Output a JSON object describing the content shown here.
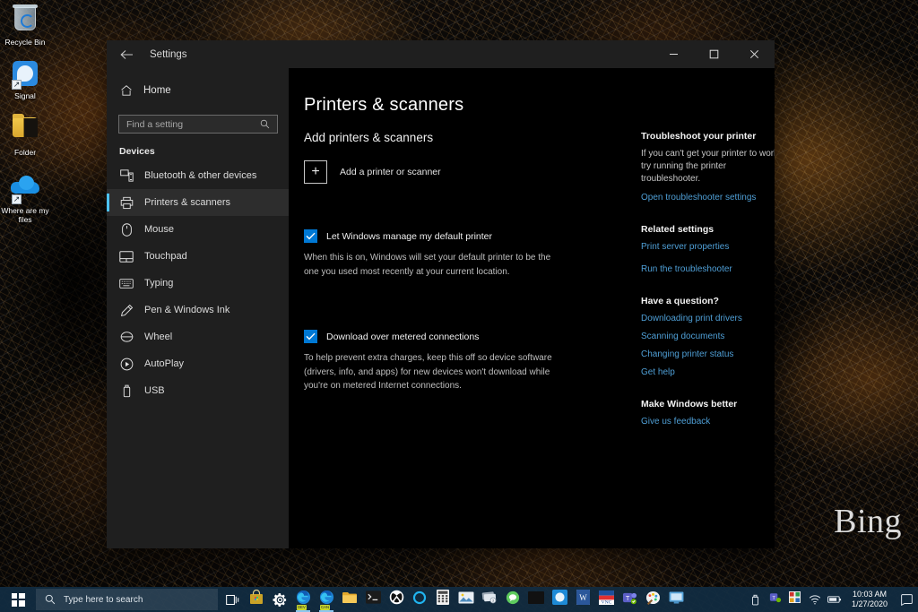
{
  "desktop": {
    "watermark": "Bing",
    "icons": [
      {
        "name": "recycle-bin",
        "label": "Recycle Bin",
        "icon": "recycle-bin-icon",
        "shortcut": false
      },
      {
        "name": "signal",
        "label": "Signal",
        "icon": "signal-app-icon",
        "shortcut": true
      },
      {
        "name": "folder",
        "label": "Folder",
        "icon": "folder-icon",
        "shortcut": false
      },
      {
        "name": "where-are-my-files",
        "label": "Where are my files",
        "icon": "onedrive-cloud-icon",
        "shortcut": true
      }
    ]
  },
  "window": {
    "title": "Settings",
    "back_icon": "back-arrow-icon",
    "controls": {
      "minimize": "–",
      "maximize": "☐",
      "close": "✕"
    }
  },
  "nav": {
    "home_label": "Home",
    "home_icon": "home-icon",
    "search": {
      "placeholder": "Find a setting",
      "value": "",
      "icon": "search-icon"
    },
    "group_title": "Devices",
    "items": [
      {
        "label": "Bluetooth & other devices",
        "icon": "bluetooth-devices-icon",
        "selected": false
      },
      {
        "label": "Printers & scanners",
        "icon": "printer-icon",
        "selected": true
      },
      {
        "label": "Mouse",
        "icon": "mouse-icon",
        "selected": false
      },
      {
        "label": "Touchpad",
        "icon": "touchpad-icon",
        "selected": false
      },
      {
        "label": "Typing",
        "icon": "keyboard-icon",
        "selected": false
      },
      {
        "label": "Pen & Windows Ink",
        "icon": "pen-icon",
        "selected": false
      },
      {
        "label": "Wheel",
        "icon": "wheel-icon",
        "selected": false
      },
      {
        "label": "AutoPlay",
        "icon": "autoplay-icon",
        "selected": false
      },
      {
        "label": "USB",
        "icon": "usb-icon",
        "selected": false
      }
    ]
  },
  "main": {
    "page_title": "Printers & scanners",
    "section_title": "Add printers & scanners",
    "add_button": {
      "label": "Add a printer or scanner",
      "icon": "plus-icon"
    },
    "options": [
      {
        "label": "Let Windows manage my default printer",
        "checked": true,
        "description": "When this is on, Windows will set your default printer to be the one you used most recently at your current location."
      },
      {
        "label": "Download over metered connections",
        "checked": true,
        "description": "To help prevent extra charges, keep this off so device software (drivers, info, and apps) for new devices won't download while you're on metered Internet connections."
      }
    ]
  },
  "rail": {
    "troubleshoot": {
      "heading": "Troubleshoot your printer",
      "body": "If you can't get your printer to work, try running the printer troubleshooter.",
      "link": "Open troubleshooter settings"
    },
    "related": {
      "heading": "Related settings",
      "links": [
        "Print server properties",
        "Run the troubleshooter"
      ]
    },
    "question": {
      "heading": "Have a question?",
      "links": [
        "Downloading print drivers",
        "Scanning documents",
        "Changing printer status",
        "Get help"
      ]
    },
    "feedback": {
      "heading": "Make Windows better",
      "link": "Give us feedback"
    }
  },
  "taskbar": {
    "start_icon": "windows-start-icon",
    "search": {
      "placeholder": "Type here to search",
      "icon": "search-icon"
    },
    "task_view_icon": "task-view-icon",
    "pinned": [
      {
        "name": "microsoft-store",
        "icon": "store-icon"
      },
      {
        "name": "settings",
        "icon": "gear-icon"
      },
      {
        "name": "edge-dev",
        "icon": "edge-icon",
        "badge": "DEV",
        "running": true
      },
      {
        "name": "edge-canary",
        "icon": "edge-icon",
        "badge": "CAN",
        "running": true
      },
      {
        "name": "file-explorer",
        "icon": "folder-icon"
      },
      {
        "name": "terminal",
        "icon": "terminal-icon"
      },
      {
        "name": "xbox",
        "icon": "xbox-icon"
      },
      {
        "name": "cortana",
        "icon": "cortana-icon"
      },
      {
        "name": "calculator",
        "icon": "calculator-icon"
      },
      {
        "name": "photos",
        "icon": "photos-icon"
      },
      {
        "name": "sticky-notes",
        "icon": "notes-icon"
      },
      {
        "name": "messaging",
        "icon": "messaging-icon"
      },
      {
        "name": "movies-tv",
        "icon": "movies-icon"
      },
      {
        "name": "skype",
        "icon": "skype-icon"
      },
      {
        "name": "word",
        "icon": "word-icon"
      },
      {
        "name": "vnc-viewer",
        "icon": "vnc-icon"
      },
      {
        "name": "microsoft-teams",
        "icon": "teams-icon"
      },
      {
        "name": "paint-3d",
        "icon": "paint-icon"
      },
      {
        "name": "remote-desktop",
        "icon": "remote-desktop-icon"
      }
    ],
    "tray": [
      {
        "name": "usb-eject",
        "icon": "usb-tray-icon"
      },
      {
        "name": "teams-tray",
        "icon": "teams-icon"
      },
      {
        "name": "color-tray",
        "icon": "color-tray-icon"
      },
      {
        "name": "network",
        "icon": "wifi-icon"
      },
      {
        "name": "battery",
        "icon": "battery-icon"
      }
    ],
    "clock": {
      "time": "10:03 AM",
      "date": "1/27/2020"
    },
    "action_center_icon": "action-center-icon"
  },
  "colors": {
    "accent": "#0078d4",
    "selection_bar": "#4cc2ff",
    "link": "#4f9fd6",
    "window_chrome": "#1f1f1f",
    "content_bg": "#000000",
    "taskbar": "#112c42"
  }
}
